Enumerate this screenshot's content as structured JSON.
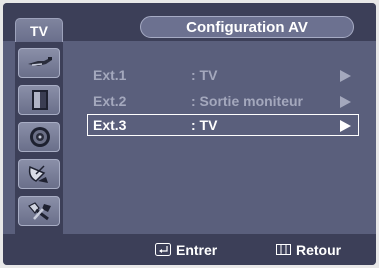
{
  "header": {
    "tab_label": "TV",
    "title": "Configuration AV"
  },
  "sidebar": {
    "items": [
      {
        "icon": "antenna-icon"
      },
      {
        "icon": "picture-icon"
      },
      {
        "icon": "sound-icon"
      },
      {
        "icon": "satellite-dish-icon"
      },
      {
        "icon": "tools-icon"
      }
    ]
  },
  "menu": {
    "rows": [
      {
        "label": "Ext.1",
        "value": ": TV",
        "selected": false
      },
      {
        "label": "Ext.2",
        "value": ": Sortie moniteur",
        "selected": false
      },
      {
        "label": "Ext.3",
        "value": ": TV",
        "selected": true
      }
    ]
  },
  "footer": {
    "enter_label": "Entrer",
    "return_label": "Retour"
  },
  "colors": {
    "panel": "#5a5f7c",
    "bar": "#3c3f58",
    "inactive_text": "#a4a8bd",
    "active_text": "#ffffff"
  }
}
